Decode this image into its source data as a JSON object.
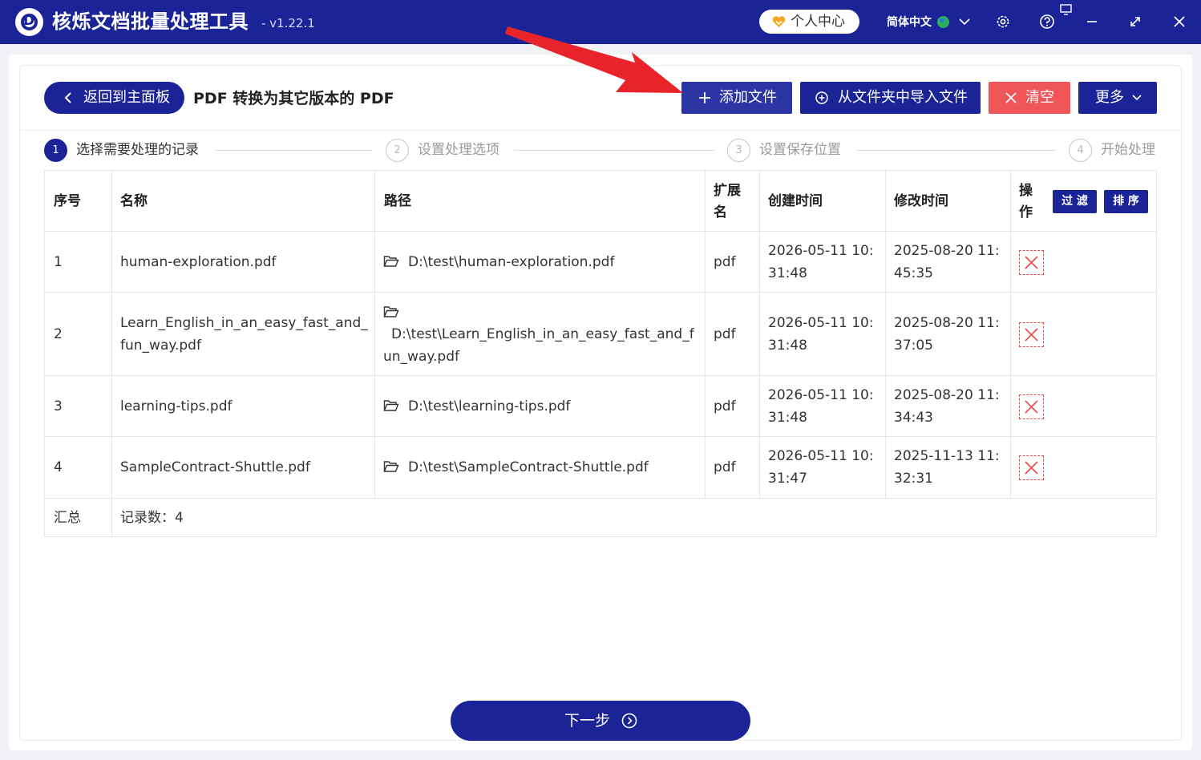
{
  "app": {
    "title": "核烁文档批量处理工具",
    "version": "- v1.22.1",
    "user_center_label": "个人中心",
    "language_label": "简体中文"
  },
  "toolbar": {
    "back_label": "返回到主面板",
    "page_title": "PDF 转换为其它版本的 PDF",
    "add_file_label": "添加文件",
    "import_folder_label": "从文件夹中导入文件",
    "clear_label": "清空",
    "more_label": "更多"
  },
  "steps": [
    {
      "num": "1",
      "label": "选择需要处理的记录"
    },
    {
      "num": "2",
      "label": "设置处理选项"
    },
    {
      "num": "3",
      "label": "设置保存位置"
    },
    {
      "num": "4",
      "label": "开始处理"
    }
  ],
  "table": {
    "headers": {
      "index": "序号",
      "name": "名称",
      "path": "路径",
      "ext_line1": "扩展",
      "ext_line2": "名",
      "created": "创建时间",
      "modified": "修改时间",
      "action_line1": "操",
      "action_line2": "作"
    },
    "filter_label": "过 滤",
    "sort_label": "排 序",
    "rows": [
      {
        "index": "1",
        "name": "human-exploration.pdf",
        "path": "D:\\test\\human-exploration.pdf",
        "ext": "pdf",
        "created": "2026-05-11 10:31:48",
        "modified": "2025-08-20 11:45:35"
      },
      {
        "index": "2",
        "name": "Learn_English_in_an_easy_fast_and_fun_way.pdf",
        "path": "D:\\test\\Learn_English_in_an_easy_fast_and_fun_way.pdf",
        "ext": "pdf",
        "created": "2026-05-11 10:31:48",
        "modified": "2025-08-20 11:37:05"
      },
      {
        "index": "3",
        "name": "learning-tips.pdf",
        "path": "D:\\test\\learning-tips.pdf",
        "ext": "pdf",
        "created": "2026-05-11 10:31:48",
        "modified": "2025-08-20 11:34:43"
      },
      {
        "index": "4",
        "name": "SampleContract-Shuttle.pdf",
        "path": "D:\\test\\SampleContract-Shuttle.pdf",
        "ext": "pdf",
        "created": "2026-05-11 10:31:47",
        "modified": "2025-11-13 11:32:31"
      }
    ],
    "summary": {
      "label": "汇总",
      "count_text": "记录数：4"
    }
  },
  "footer": {
    "next_label": "下一步"
  },
  "colors": {
    "primary": "#1b2496",
    "danger": "#f0555a",
    "arrow": "#e8242a"
  }
}
